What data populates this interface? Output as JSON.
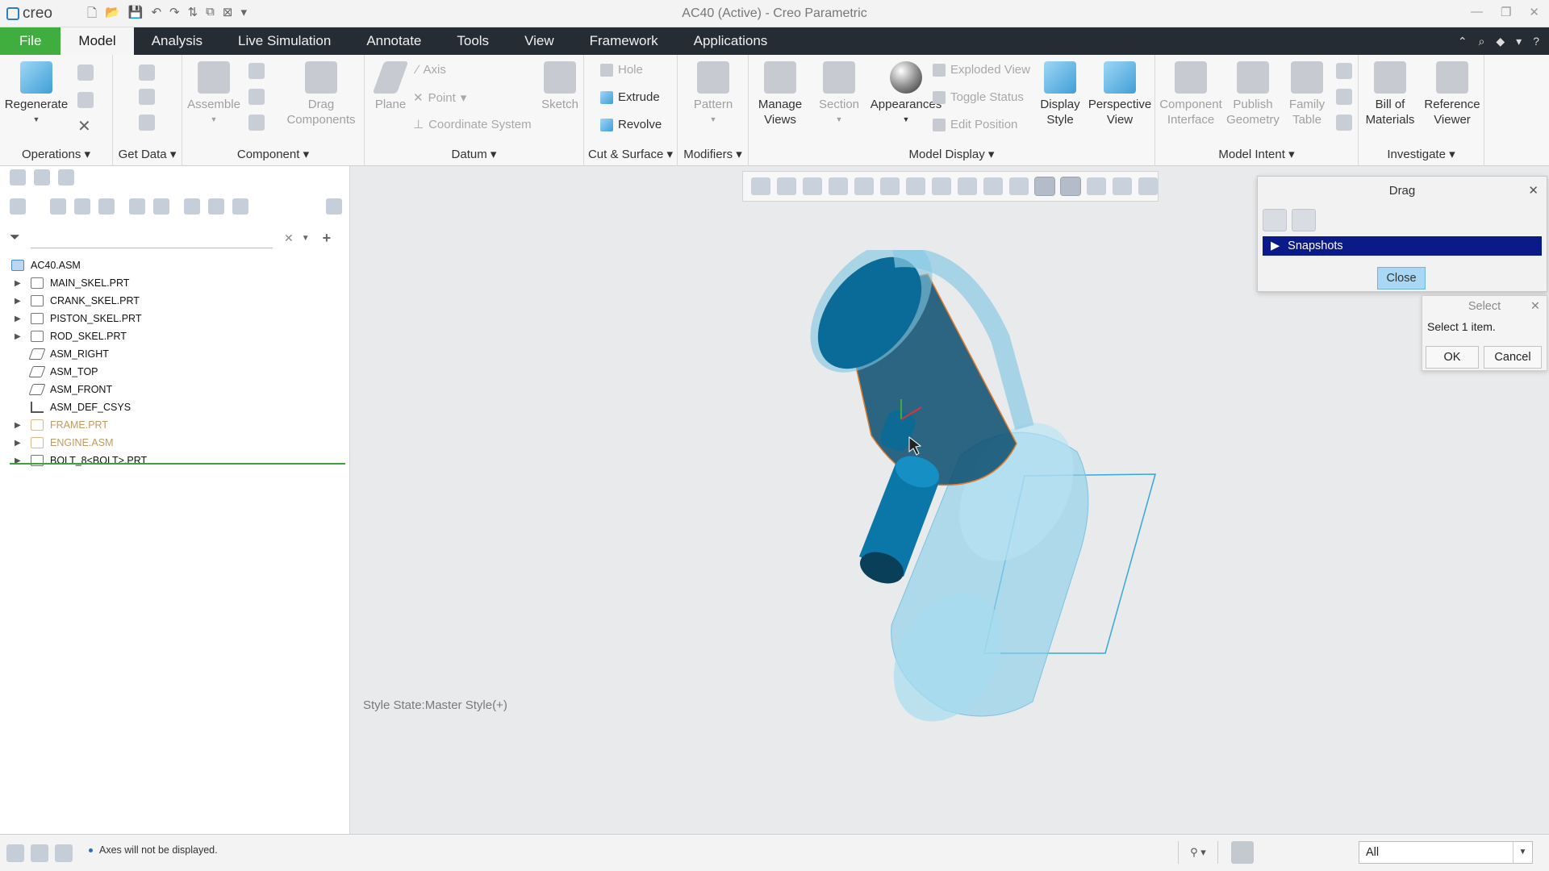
{
  "app": {
    "logo_text": "creo",
    "window_title": "AC40 (Active) - Creo Parametric"
  },
  "tabs": [
    {
      "label": "File"
    },
    {
      "label": "Model"
    },
    {
      "label": "Analysis"
    },
    {
      "label": "Live Simulation"
    },
    {
      "label": "Annotate"
    },
    {
      "label": "Tools"
    },
    {
      "label": "View"
    },
    {
      "label": "Framework"
    },
    {
      "label": "Applications"
    }
  ],
  "ribbon": {
    "operations": {
      "label": "Operations",
      "regenerate": "Regenerate"
    },
    "get_data": {
      "label": "Get Data"
    },
    "component": {
      "label": "Component",
      "assemble": "Assemble",
      "drag": "Drag Components"
    },
    "datum": {
      "label": "Datum",
      "plane": "Plane",
      "axis": "Axis",
      "point": "Point",
      "csys": "Coordinate System",
      "sketch": "Sketch"
    },
    "cut_surface": {
      "label": "Cut & Surface",
      "hole": "Hole",
      "extrude": "Extrude",
      "revolve": "Revolve"
    },
    "modifiers": {
      "label": "Modifiers",
      "pattern": "Pattern"
    },
    "model_display": {
      "label": "Model Display",
      "manage_views": "Manage Views",
      "section": "Section",
      "appearances": "Appearances",
      "exploded": "Exploded View",
      "toggle_status": "Toggle Status",
      "edit_position": "Edit Position",
      "display_style": "Display Style",
      "perspective": "Perspective View"
    },
    "model_intent": {
      "label": "Model Intent",
      "component_interface": "Component Interface",
      "publish_geometry": "Publish Geometry",
      "family_table": "Family Table"
    },
    "investigate": {
      "label": "Investigate",
      "bom": "Bill of Materials",
      "reference_viewer": "Reference Viewer"
    }
  },
  "model_tree": {
    "filter_placeholder": "",
    "root": "AC40.ASM",
    "items": [
      {
        "name": "MAIN_SKEL.PRT",
        "icon": "skeleton-part-icon",
        "expandable": true
      },
      {
        "name": "CRANK_SKEL.PRT",
        "icon": "skeleton-part-icon",
        "expandable": true
      },
      {
        "name": "PISTON_SKEL.PRT",
        "icon": "skeleton-part-icon",
        "expandable": true
      },
      {
        "name": "ROD_SKEL.PRT",
        "icon": "skeleton-part-icon",
        "expandable": true
      },
      {
        "name": "ASM_RIGHT",
        "icon": "datum-plane-icon",
        "expandable": false
      },
      {
        "name": "ASM_TOP",
        "icon": "datum-plane-icon",
        "expandable": false
      },
      {
        "name": "ASM_FRONT",
        "icon": "datum-plane-icon",
        "expandable": false
      },
      {
        "name": "ASM_DEF_CSYS",
        "icon": "csys-icon",
        "expandable": false
      },
      {
        "name": "FRAME.PRT",
        "icon": "part-icon",
        "expandable": true
      },
      {
        "name": "ENGINE.ASM",
        "icon": "assembly-icon",
        "expandable": true
      },
      {
        "name": "BOLT_8<BOLT>.PRT",
        "icon": "part-icon",
        "expandable": true
      }
    ]
  },
  "graphics": {
    "style_state": "Style State:Master Style(+)"
  },
  "drag_dialog": {
    "title": "Drag",
    "snapshots_label": "Snapshots",
    "close_button": "Close"
  },
  "select_dialog": {
    "title": "Select",
    "message": "Select 1 item.",
    "ok": "OK",
    "cancel": "Cancel"
  },
  "status_bar": {
    "message": "Axes will not be displayed.",
    "selection_filter": "All"
  },
  "colors": {
    "file_tab": "#3fae3f",
    "tab_bar": "#262c34",
    "model_blue": "#0a77a8",
    "snapshot_highlight": "#0a1a88"
  }
}
